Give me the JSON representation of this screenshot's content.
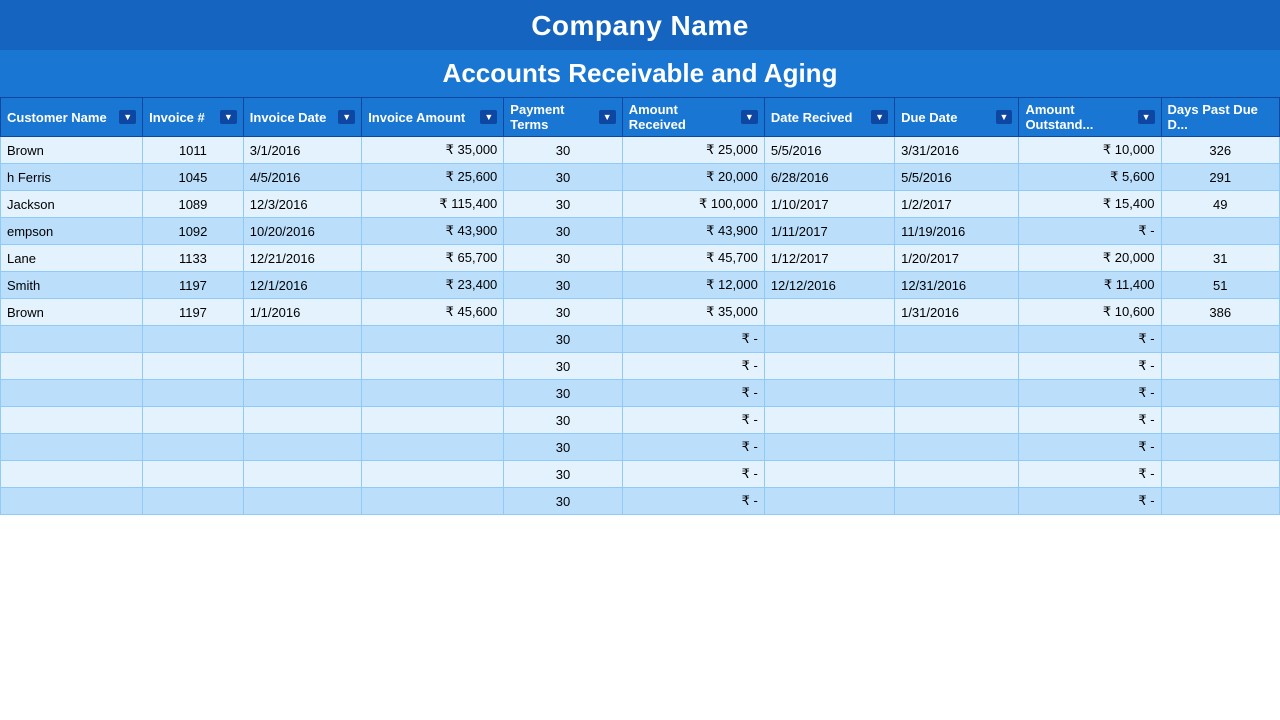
{
  "header": {
    "company_name": "Company Name",
    "subtitle": "Accounts Receivable and Aging"
  },
  "columns": [
    {
      "key": "customer_name",
      "label": "Customer Name",
      "has_dropdown": true
    },
    {
      "key": "invoice_num",
      "label": "Invoice #",
      "has_dropdown": true
    },
    {
      "key": "invoice_date",
      "label": "Invoice Date",
      "has_dropdown": true
    },
    {
      "key": "invoice_amount",
      "label": "Invoice Amount",
      "has_dropdown": true
    },
    {
      "key": "payment_terms",
      "label": "Payment Terms",
      "has_dropdown": true
    },
    {
      "key": "amount_received",
      "label": "Amount Received",
      "has_dropdown": true
    },
    {
      "key": "date_received",
      "label": "Date Recived",
      "has_dropdown": true
    },
    {
      "key": "due_date",
      "label": "Due Date",
      "has_dropdown": true
    },
    {
      "key": "amount_outstanding",
      "label": "Amount Outstand...",
      "has_dropdown": true
    },
    {
      "key": "days_past_due",
      "label": "Days Past Due D...",
      "has_dropdown": false
    }
  ],
  "rows": [
    {
      "customer_name": "Brown",
      "invoice_num": "1011",
      "invoice_date": "3/1/2016",
      "invoice_amount": "₹   35,000",
      "payment_terms": "30",
      "amount_received": "₹   25,000",
      "date_received": "5/5/2016",
      "due_date": "3/31/2016",
      "amount_outstanding": "₹   10,000",
      "days_past_due": "326"
    },
    {
      "customer_name": "h Ferris",
      "invoice_num": "1045",
      "invoice_date": "4/5/2016",
      "invoice_amount": "₹   25,600",
      "payment_terms": "30",
      "amount_received": "₹   20,000",
      "date_received": "6/28/2016",
      "due_date": "5/5/2016",
      "amount_outstanding": "₹     5,600",
      "days_past_due": "291"
    },
    {
      "customer_name": "Jackson",
      "invoice_num": "1089",
      "invoice_date": "12/3/2016",
      "invoice_amount": "₹ 115,400",
      "payment_terms": "30",
      "amount_received": "₹ 100,000",
      "date_received": "1/10/2017",
      "due_date": "1/2/2017",
      "amount_outstanding": "₹   15,400",
      "days_past_due": "49"
    },
    {
      "customer_name": "empson",
      "invoice_num": "1092",
      "invoice_date": "10/20/2016",
      "invoice_amount": "₹   43,900",
      "payment_terms": "30",
      "amount_received": "₹   43,900",
      "date_received": "1/11/2017",
      "due_date": "11/19/2016",
      "amount_outstanding": "₹         -",
      "days_past_due": ""
    },
    {
      "customer_name": "Lane",
      "invoice_num": "1133",
      "invoice_date": "12/21/2016",
      "invoice_amount": "₹   65,700",
      "payment_terms": "30",
      "amount_received": "₹   45,700",
      "date_received": "1/12/2017",
      "due_date": "1/20/2017",
      "amount_outstanding": "₹   20,000",
      "days_past_due": "31"
    },
    {
      "customer_name": "Smith",
      "invoice_num": "1197",
      "invoice_date": "12/1/2016",
      "invoice_amount": "₹   23,400",
      "payment_terms": "30",
      "amount_received": "₹   12,000",
      "date_received": "12/12/2016",
      "due_date": "12/31/2016",
      "amount_outstanding": "₹   11,400",
      "days_past_due": "51"
    },
    {
      "customer_name": "Brown",
      "invoice_num": "1197",
      "invoice_date": "1/1/2016",
      "invoice_amount": "₹   45,600",
      "payment_terms": "30",
      "amount_received": "₹   35,000",
      "date_received": "",
      "due_date": "1/31/2016",
      "amount_outstanding": "₹   10,600",
      "days_past_due": "386"
    },
    {
      "customer_name": "",
      "invoice_num": "",
      "invoice_date": "",
      "invoice_amount": "",
      "payment_terms": "30",
      "amount_received": "₹         -",
      "date_received": "",
      "due_date": "",
      "amount_outstanding": "₹         -",
      "days_past_due": ""
    },
    {
      "customer_name": "",
      "invoice_num": "",
      "invoice_date": "",
      "invoice_amount": "",
      "payment_terms": "30",
      "amount_received": "₹         -",
      "date_received": "",
      "due_date": "",
      "amount_outstanding": "₹         -",
      "days_past_due": ""
    },
    {
      "customer_name": "",
      "invoice_num": "",
      "invoice_date": "",
      "invoice_amount": "",
      "payment_terms": "30",
      "amount_received": "₹         -",
      "date_received": "",
      "due_date": "",
      "amount_outstanding": "₹         -",
      "days_past_due": ""
    },
    {
      "customer_name": "",
      "invoice_num": "",
      "invoice_date": "",
      "invoice_amount": "",
      "payment_terms": "30",
      "amount_received": "₹         -",
      "date_received": "",
      "due_date": "",
      "amount_outstanding": "₹         -",
      "days_past_due": ""
    },
    {
      "customer_name": "",
      "invoice_num": "",
      "invoice_date": "",
      "invoice_amount": "",
      "payment_terms": "30",
      "amount_received": "₹         -",
      "date_received": "",
      "due_date": "",
      "amount_outstanding": "₹         -",
      "days_past_due": ""
    },
    {
      "customer_name": "",
      "invoice_num": "",
      "invoice_date": "",
      "invoice_amount": "",
      "payment_terms": "30",
      "amount_received": "₹         -",
      "date_received": "",
      "due_date": "",
      "amount_outstanding": "₹         -",
      "days_past_due": ""
    },
    {
      "customer_name": "",
      "invoice_num": "",
      "invoice_date": "",
      "invoice_amount": "",
      "payment_terms": "30",
      "amount_received": "₹         -",
      "date_received": "",
      "due_date": "",
      "amount_outstanding": "₹         -",
      "days_past_due": ""
    }
  ],
  "colors": {
    "header_bg": "#1565c0",
    "subheader_bg": "#1976d2",
    "th_bg": "#1976d2",
    "row_odd": "#e3f2fd",
    "row_even": "#bbdefb",
    "border": "#90caf9"
  }
}
